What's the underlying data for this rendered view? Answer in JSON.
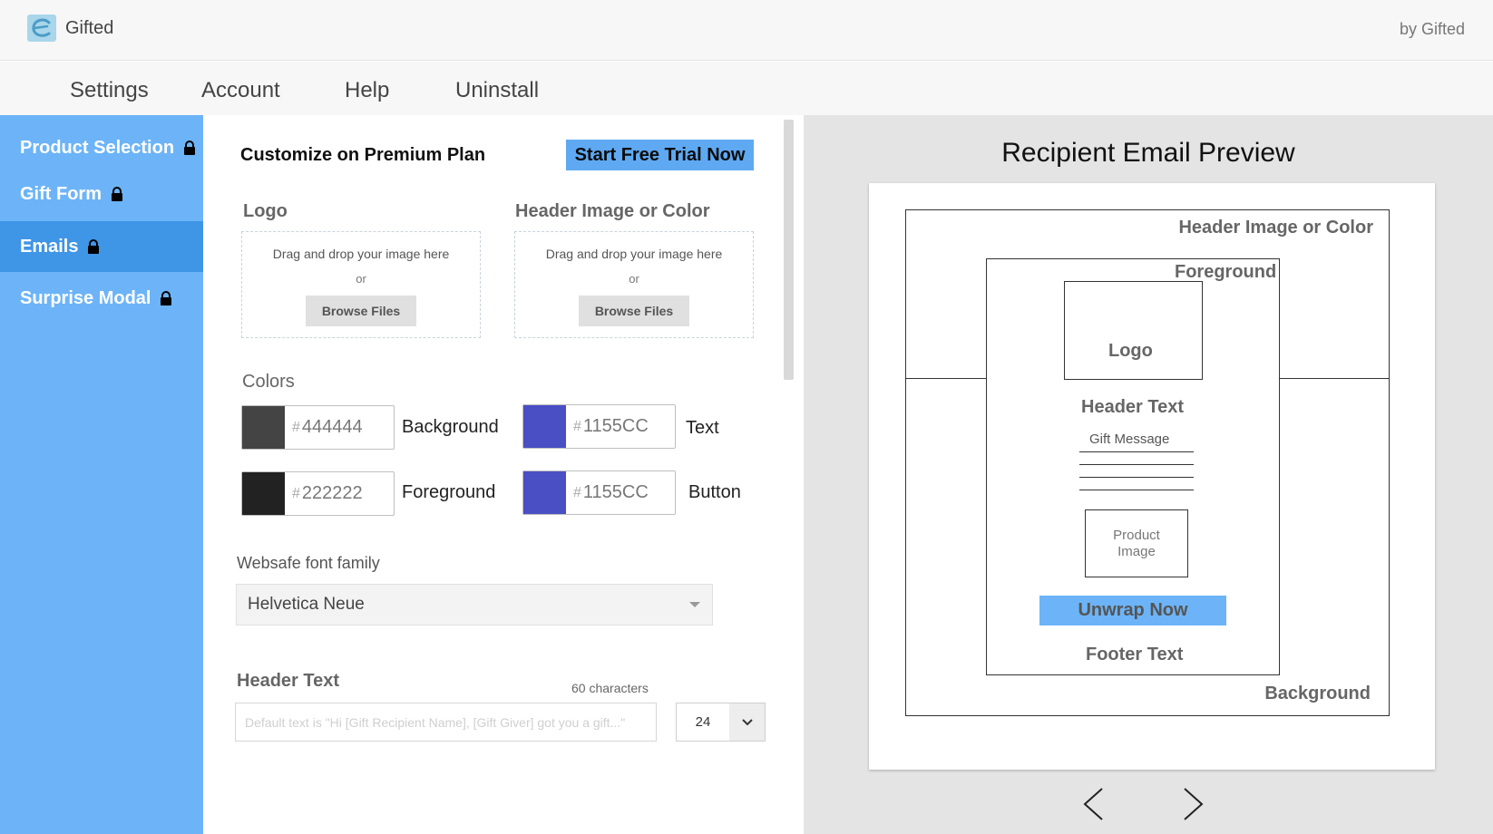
{
  "app": {
    "title": "Gifted",
    "byline": "by Gifted",
    "accent": "#6cb4f7",
    "accent_active": "#3f95e6"
  },
  "nav": {
    "items": [
      "Settings",
      "Account",
      "Help",
      "Uninstall"
    ]
  },
  "sidebar": {
    "items": [
      {
        "label": "Product Selection",
        "icon": "lock-icon",
        "active": false
      },
      {
        "label": "Gift Form",
        "icon": "lock-icon",
        "active": false
      },
      {
        "label": "Emails",
        "icon": "lock-icon",
        "active": true
      },
      {
        "label": "Surprise Modal",
        "icon": "lock-icon",
        "active": false
      }
    ]
  },
  "settings": {
    "plan_title": "Customize on Premium Plan",
    "trial_button": "Start Free Trial Now",
    "logo": {
      "label": "Logo",
      "drop_text": "Drag and drop your image here",
      "or": "or",
      "browse": "Browse Files"
    },
    "header_image": {
      "label": "Header Image or Color",
      "drop_text": "Drag and drop your image here",
      "or": "or",
      "browse": "Browse Files"
    },
    "colors": {
      "label": "Colors",
      "hash": "#",
      "background": {
        "caption": "Background",
        "hex": "444444",
        "swatch": "#444444"
      },
      "text": {
        "caption": "Text",
        "hex": "1155CC",
        "swatch": "#4a4fc4"
      },
      "foreground": {
        "caption": "Foreground",
        "hex": "222222",
        "swatch": "#222222"
      },
      "button": {
        "caption": "Button",
        "hex": "1155CC",
        "swatch": "#4a4fc4"
      }
    },
    "font": {
      "label": "Websafe font family",
      "selected": "Helvetica Neue"
    },
    "header_text": {
      "label": "Header Text",
      "char_limit": "60 characters",
      "placeholder": "Default text is \"Hi [Gift Recipient Name], [Gift Giver] got you a gift...\"",
      "font_size": "24"
    }
  },
  "preview": {
    "title": "Recipient Email Preview",
    "header_image": "Header Image or Color",
    "foreground": "Foreground",
    "logo": "Logo",
    "header_text": "Header Text",
    "gift_message": "Gift Message",
    "product_image": "Product Image",
    "unwrap_button": "Unwrap Now",
    "footer_text": "Footer Text",
    "background": "Background"
  }
}
